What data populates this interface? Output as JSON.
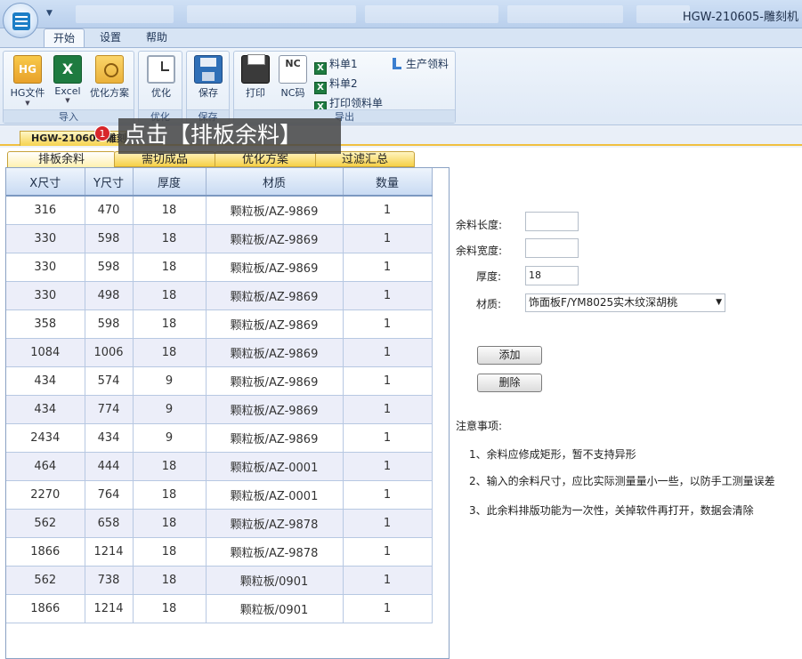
{
  "window": {
    "title": "HGW-210605-雕刻机"
  },
  "ribbon_tabs": [
    "开始",
    "设置",
    "帮助"
  ],
  "ribbon": {
    "import_group": "导入",
    "optimize_group": "优化",
    "save_group": "保存",
    "export_group": "导出",
    "hg_file": "HG文件",
    "hg_icon_text": "HG",
    "excel": "Excel",
    "excel_icon_text": "X",
    "opt_plan": "优化方案",
    "optimize": "优化",
    "save": "保存",
    "print": "打印",
    "nc_code": "NC码",
    "nc_icon_text": "NC",
    "list1": "料单1",
    "list2": "料单2",
    "print_pick_list": "打印领料单",
    "production_pick": "生产领料"
  },
  "document_tab": "HGW-210605-雕刻机",
  "callout": {
    "badge": "1",
    "text": "点击【排板余料】"
  },
  "inner_tabs": [
    "排板余料",
    "需切成品",
    "优化方案",
    "过滤汇总"
  ],
  "table": {
    "headers": [
      "X尺寸",
      "Y尺寸",
      "厚度",
      "材质",
      "数量"
    ],
    "rows": [
      [
        "316",
        "470",
        "18",
        "颗粒板/AZ-9869",
        "1"
      ],
      [
        "330",
        "598",
        "18",
        "颗粒板/AZ-9869",
        "1"
      ],
      [
        "330",
        "598",
        "18",
        "颗粒板/AZ-9869",
        "1"
      ],
      [
        "330",
        "498",
        "18",
        "颗粒板/AZ-9869",
        "1"
      ],
      [
        "358",
        "598",
        "18",
        "颗粒板/AZ-9869",
        "1"
      ],
      [
        "1084",
        "1006",
        "18",
        "颗粒板/AZ-9869",
        "1"
      ],
      [
        "434",
        "574",
        "9",
        "颗粒板/AZ-9869",
        "1"
      ],
      [
        "434",
        "774",
        "9",
        "颗粒板/AZ-9869",
        "1"
      ],
      [
        "2434",
        "434",
        "9",
        "颗粒板/AZ-9869",
        "1"
      ],
      [
        "464",
        "444",
        "18",
        "颗粒板/AZ-0001",
        "1"
      ],
      [
        "2270",
        "764",
        "18",
        "颗粒板/AZ-0001",
        "1"
      ],
      [
        "562",
        "658",
        "18",
        "颗粒板/AZ-9878",
        "1"
      ],
      [
        "1866",
        "1214",
        "18",
        "颗粒板/AZ-9878",
        "1"
      ],
      [
        "562",
        "738",
        "18",
        "颗粒板/0901",
        "1"
      ],
      [
        "1866",
        "1214",
        "18",
        "颗粒板/0901",
        "1"
      ]
    ]
  },
  "form": {
    "remnant_length_label": "余料长度:",
    "remnant_width_label": "余料宽度:",
    "thickness_label": "厚度:",
    "material_label": "材质:",
    "remnant_length_value": "",
    "remnant_width_value": "",
    "thickness_value": "18",
    "material_value": "饰面板F/YM8025实木纹深胡桃",
    "add_button": "添加",
    "delete_button": "删除"
  },
  "notes": {
    "title": "注意事项:",
    "items": [
      "1、余料应修成矩形，暂不支持异形",
      "2、输入的余料尺寸，应比实际测量量小一些，以防手工测量误差",
      "3、此余料排版功能为一次性，关掉软件再打开，数据会清除"
    ]
  }
}
